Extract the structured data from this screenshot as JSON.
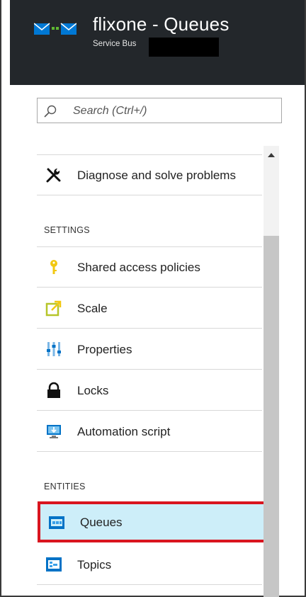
{
  "header": {
    "title": "flixone - Queues",
    "subtitle": "Service Bus",
    "logo_icon": "service-bus-icon"
  },
  "search": {
    "placeholder": "Search (Ctrl+/)",
    "icon": "search-icon"
  },
  "menu": {
    "top_items": [
      {
        "label": "Diagnose and solve problems",
        "icon": "wrench-tools-icon"
      }
    ],
    "settings": {
      "title": "SETTINGS",
      "items": [
        {
          "label": "Shared access policies",
          "icon": "key-icon"
        },
        {
          "label": "Scale",
          "icon": "scale-icon"
        },
        {
          "label": "Properties",
          "icon": "properties-icon"
        },
        {
          "label": "Locks",
          "icon": "lock-icon"
        },
        {
          "label": "Automation script",
          "icon": "automation-script-icon"
        }
      ]
    },
    "entities": {
      "title": "ENTITIES",
      "items": [
        {
          "label": "Queues",
          "icon": "queues-icon",
          "selected": true
        },
        {
          "label": "Topics",
          "icon": "topics-icon"
        }
      ]
    }
  },
  "colors": {
    "header_bg": "#23272b",
    "selected_bg": "#cdeef9",
    "selected_border": "#d9151f",
    "accent_blue": "#0072c6"
  }
}
